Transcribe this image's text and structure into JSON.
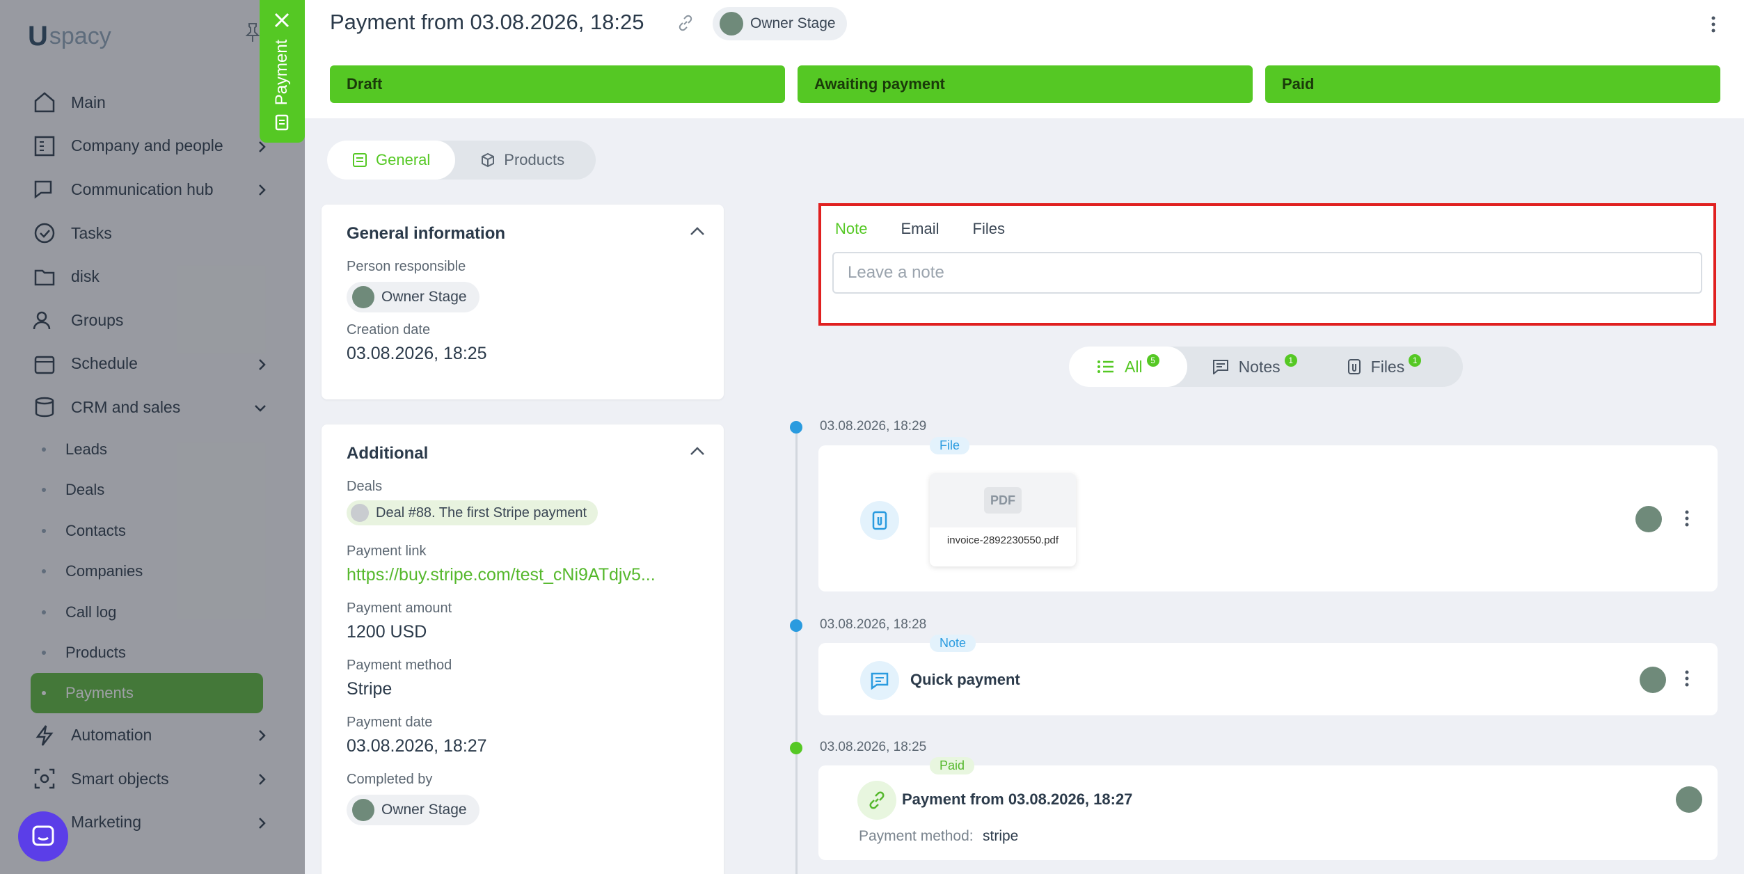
{
  "sidebar": {
    "logo": {
      "u": "U",
      "rest": "spacy"
    },
    "items": [
      {
        "label": "Main",
        "icon": "home-icon"
      },
      {
        "label": "Company and people",
        "icon": "company-icon",
        "chevron": true
      },
      {
        "label": "Communication hub",
        "icon": "chat-icon",
        "chevron": true
      },
      {
        "label": "Tasks",
        "icon": "check-circle-icon"
      },
      {
        "label": "disk",
        "icon": "folder-icon"
      },
      {
        "label": "Groups",
        "icon": "users-icon"
      },
      {
        "label": "Schedule",
        "icon": "calendar-icon",
        "chevron": true
      },
      {
        "label": "CRM and sales",
        "icon": "database-icon",
        "chevron": "down"
      }
    ],
    "subitems": [
      {
        "label": "Leads"
      },
      {
        "label": "Deals"
      },
      {
        "label": "Contacts"
      },
      {
        "label": "Companies"
      },
      {
        "label": "Call log"
      },
      {
        "label": "Products"
      },
      {
        "label": "Payments",
        "active": true
      }
    ],
    "bottom_items": [
      {
        "label": "Automation",
        "icon": "lightning-icon"
      },
      {
        "label": "Smart objects",
        "icon": "smart-objects-icon"
      },
      {
        "label": "Marketing",
        "icon": "marketing-icon"
      }
    ]
  },
  "sidetab": {
    "label": "Payment"
  },
  "header": {
    "title": "Payment from 03.08.2026, 18:25",
    "owner": "Owner Stage",
    "stages": [
      "Draft",
      "Awaiting payment",
      "Paid"
    ]
  },
  "tabs": [
    {
      "label": "General",
      "active": true
    },
    {
      "label": "Products",
      "active": false
    }
  ],
  "general_info": {
    "title": "General information",
    "person_label": "Person responsible",
    "person": "Owner Stage",
    "created_label": "Creation date",
    "created": "03.08.2026, 18:25"
  },
  "additional": {
    "title": "Additional",
    "deals_label": "Deals",
    "deal": "Deal #88. The first Stripe payment",
    "link_label": "Payment link",
    "link": "https://buy.stripe.com/test_cNi9ATdjv5...",
    "amount_label": "Payment amount",
    "amount": "1200 USD",
    "method_label": "Payment method",
    "method": "Stripe",
    "date_label": "Payment date",
    "date": "03.08.2026, 18:27",
    "completed_label": "Completed by",
    "completed": "Owner Stage"
  },
  "note": {
    "tabs": [
      "Note",
      "Email",
      "Files"
    ],
    "placeholder": "Leave a note"
  },
  "filter": [
    {
      "label": "All",
      "count": "5"
    },
    {
      "label": "Notes",
      "count": "1"
    },
    {
      "label": "Files",
      "count": "1"
    }
  ],
  "timeline": [
    {
      "date": "03.08.2026, 18:29",
      "tag": "File",
      "filename": "invoice-2892230550.pdf",
      "file_icon": "PDF"
    },
    {
      "date": "03.08.2026, 18:28",
      "tag": "Note",
      "text": "Quick payment"
    },
    {
      "date": "03.08.2026, 18:25",
      "tag": "Paid",
      "title": "Payment from 03.08.2026, 18:27",
      "method_label": "Payment method:",
      "method": "stripe"
    }
  ],
  "colors": {
    "accent": "#55c824",
    "highlight": "#e02020",
    "info": "#2a9bdf"
  }
}
